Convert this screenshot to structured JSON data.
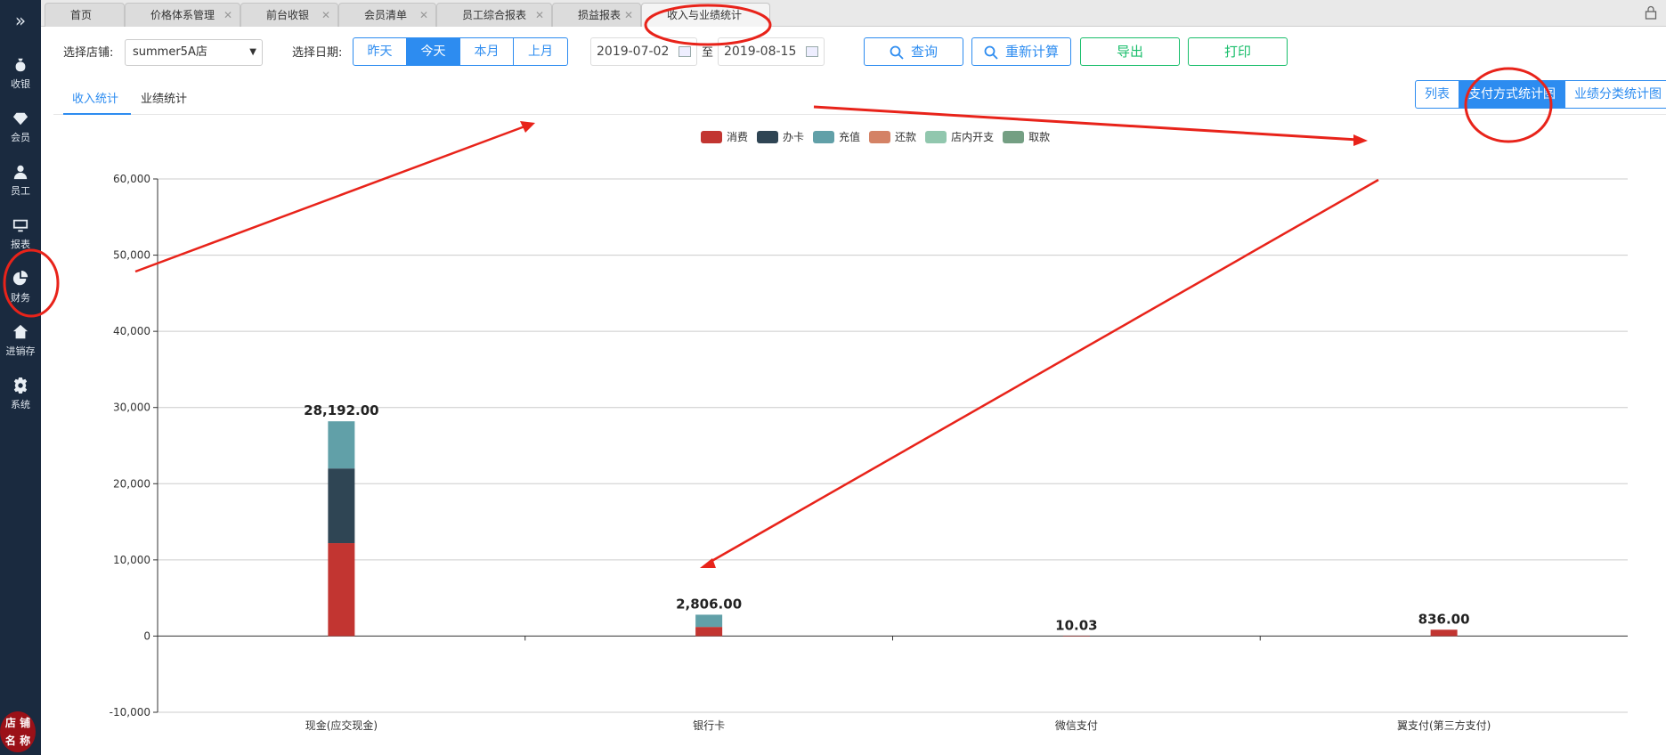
{
  "sidebar": {
    "toggle": "»",
    "items": [
      {
        "label": "收银",
        "icon": "money-bag-icon"
      },
      {
        "label": "会员",
        "icon": "diamond-icon"
      },
      {
        "label": "员工",
        "icon": "user-icon"
      },
      {
        "label": "报表",
        "icon": "monitor-icon"
      },
      {
        "label": "财务",
        "icon": "pie-chart-icon"
      },
      {
        "label": "进销存",
        "icon": "house-icon"
      },
      {
        "label": "系统",
        "icon": "gear-icon"
      }
    ],
    "logo_line1": "店 铺",
    "logo_line2": "名 称"
  },
  "tabs": [
    {
      "label": "首页",
      "closable": false
    },
    {
      "label": "价格体系管理",
      "closable": true
    },
    {
      "label": "前台收银",
      "closable": true
    },
    {
      "label": "会员清单",
      "closable": true
    },
    {
      "label": "员工综合报表",
      "closable": true
    },
    {
      "label": "损益报表",
      "closable": true
    },
    {
      "label": "收入与业绩统计",
      "closable": false,
      "active": true
    }
  ],
  "toolbar": {
    "store_label": "选择店铺:",
    "store_value": "summer5A店",
    "date_label": "选择日期:",
    "quick_dates": [
      {
        "label": "昨天",
        "active": false
      },
      {
        "label": "今天",
        "active": true
      },
      {
        "label": "本月",
        "active": false
      },
      {
        "label": "上月",
        "active": false
      }
    ],
    "date_from": "2019-07-02",
    "to_label": "至",
    "date_to": "2019-08-15",
    "query_label": "查询",
    "recalc_label": "重新计算",
    "export_label": "导出",
    "print_label": "打印"
  },
  "subtabs": [
    {
      "label": "收入统计",
      "active": true
    },
    {
      "label": "业绩统计",
      "active": false
    }
  ],
  "view_toggle": [
    {
      "label": "列表",
      "active": false
    },
    {
      "label": "支付方式统计图",
      "active": true
    },
    {
      "label": "业绩分类统计图",
      "active": false
    }
  ],
  "chart_data": {
    "type": "bar",
    "stacked": true,
    "categories": [
      "现金(应交现金)",
      "银行卡",
      "微信支付",
      "翼支付(第三方支付)"
    ],
    "totals": [
      28192.0,
      2806.0,
      10.03,
      836.0
    ],
    "total_labels": [
      "28,192.00",
      "2,806.00",
      "10.03",
      "836.00"
    ],
    "series": [
      {
        "name": "消费",
        "color": "#c23531",
        "values": [
          12200,
          1200,
          10.03,
          836
        ]
      },
      {
        "name": "办卡",
        "color": "#2f4554",
        "values": [
          9800,
          0,
          0,
          0
        ]
      },
      {
        "name": "充值",
        "color": "#61a0a8",
        "values": [
          6192,
          1606,
          0,
          0
        ]
      },
      {
        "name": "还款",
        "color": "#d48265",
        "values": [
          0,
          0,
          0,
          0
        ]
      },
      {
        "name": "店内开支",
        "color": "#91c7ae",
        "values": [
          0,
          0,
          0,
          0
        ]
      },
      {
        "name": "取款",
        "color": "#749f83",
        "values": [
          0,
          0,
          0,
          0
        ]
      }
    ],
    "ylim": [
      -10000,
      60000
    ],
    "yticks": [
      60000,
      50000,
      40000,
      30000,
      20000,
      10000,
      0,
      -10000
    ],
    "ytick_labels": [
      "60,000",
      "50,000",
      "40,000",
      "30,000",
      "20,000",
      "10,000",
      "0",
      "-10,000"
    ],
    "grid": true,
    "legend_position": "top-center"
  }
}
